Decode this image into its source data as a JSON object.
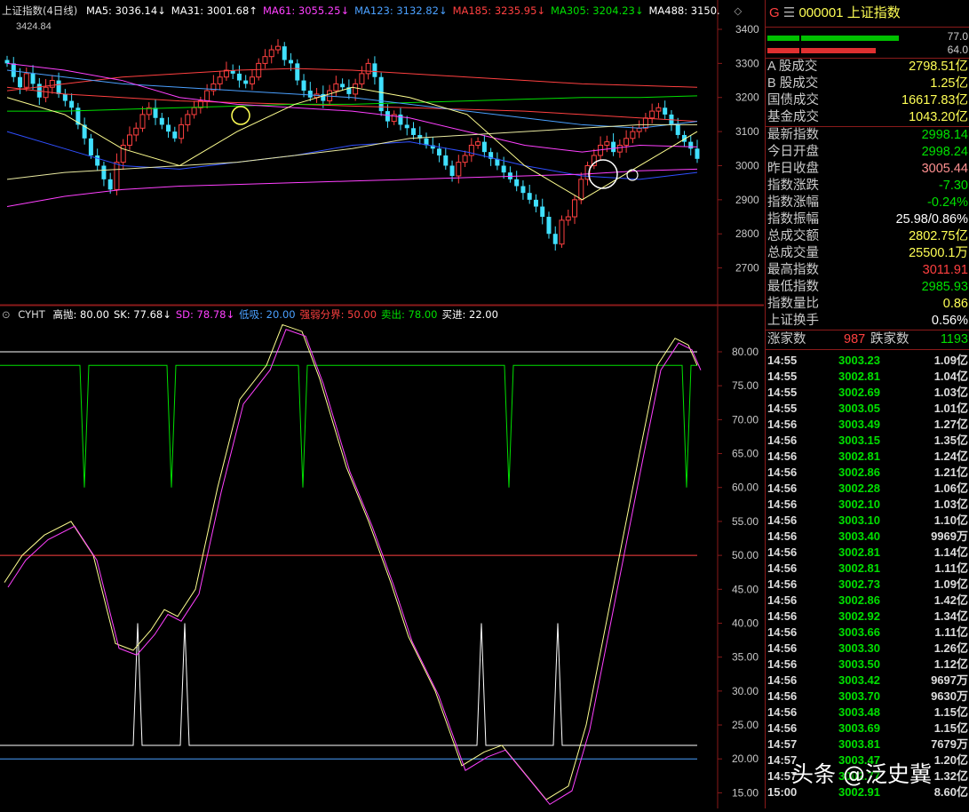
{
  "colors": {
    "red": "#ff4040",
    "green": "#00e000",
    "yellow": "#ffff55",
    "white": "#ffffff",
    "magenta": "#ff40ff",
    "blue": "#4aa0ff",
    "grid": "#8a1a1a",
    "axis": "#c8c8c8"
  },
  "main": {
    "title": "上证指数(4日线)",
    "ma": [
      {
        "label": "MA5: 3036.14",
        "arrow": "↓",
        "color": "#ffffff"
      },
      {
        "label": "MA31: 3001.68",
        "arrow": "↑",
        "color": "#ffffff"
      },
      {
        "label": "MA61: 3055.25",
        "arrow": "↓",
        "color": "#ff40ff"
      },
      {
        "label": "MA123: 3132.82",
        "arrow": "↓",
        "color": "#4aa0ff"
      },
      {
        "label": "MA185: 3235.95",
        "arrow": "↓",
        "color": "#ff4040"
      },
      {
        "label": "MA305: 3204.23",
        "arrow": "↓",
        "color": "#00e000"
      },
      {
        "label": "MA488: 3150.",
        "arrow": "",
        "color": "#ffffff"
      }
    ],
    "hi_label": "3424.84",
    "yticks": [
      "3400",
      "3300",
      "3200",
      "3100",
      "3000",
      "2900",
      "2800",
      "2700"
    ]
  },
  "indicator": {
    "name": "CYHT",
    "items": [
      {
        "label": "高抛: 80.00",
        "color": "#ffffff"
      },
      {
        "label": "SK: 77.68",
        "arrow": "↓",
        "color": "#ffffff"
      },
      {
        "label": "SD: 78.78",
        "arrow": "↓",
        "color": "#ff40ff"
      },
      {
        "label": "低吸: 20.00",
        "color": "#4aa0ff"
      },
      {
        "label": "强弱分界: 50.00",
        "color": "#ff4040"
      },
      {
        "label": "卖出: 78.00",
        "color": "#00e000"
      },
      {
        "label": "买进: 22.00",
        "color": "#ffffff"
      }
    ],
    "yticks": [
      "80.00",
      "75.00",
      "70.00",
      "65.00",
      "60.00",
      "55.00",
      "50.00",
      "45.00",
      "40.00",
      "35.00",
      "30.00",
      "25.00",
      "20.00",
      "15.00"
    ]
  },
  "panel": {
    "g": "G",
    "menu": "☰",
    "code": "000001",
    "name": "上证指数",
    "bar1": "77.0",
    "bar2": "64.0",
    "rows1": [
      {
        "l": "A 股成交",
        "v": "2798.51亿",
        "c": "#ffff55"
      },
      {
        "l": "B 股成交",
        "v": "1.25亿",
        "c": "#ffff55"
      },
      {
        "l": "国债成交",
        "v": "16617.83亿",
        "c": "#ffff55"
      },
      {
        "l": "基金成交",
        "v": "1043.20亿",
        "c": "#ffff55"
      }
    ],
    "rows2": [
      {
        "l": "最新指数",
        "v": "2998.14",
        "c": "#00e000"
      },
      {
        "l": "今日开盘",
        "v": "2998.24",
        "c": "#00e000"
      },
      {
        "l": "昨日收盘",
        "v": "3005.44",
        "c": "#ff9090"
      },
      {
        "l": "指数涨跌",
        "v": "-7.30",
        "c": "#00e000"
      },
      {
        "l": "指数涨幅",
        "v": "-0.24%",
        "c": "#00e000"
      },
      {
        "l": "指数振幅",
        "v": "25.98/0.86%",
        "c": "#ffffff"
      },
      {
        "l": "总成交额",
        "v": "2802.75亿",
        "c": "#ffff55"
      },
      {
        "l": "总成交量",
        "v": "25500.1万",
        "c": "#ffff55"
      },
      {
        "l": "最高指数",
        "v": "3011.91",
        "c": "#ff4040"
      },
      {
        "l": "最低指数",
        "v": "2985.93",
        "c": "#00e000"
      },
      {
        "l": "指数量比",
        "v": "0.86",
        "c": "#ffff55"
      },
      {
        "l": "上证换手",
        "v": "0.56%",
        "c": "#ffffff"
      }
    ],
    "up_label": "涨家数",
    "up": "987",
    "down_label": "跌家数",
    "down": "1193",
    "ticks": [
      {
        "t": "14:55",
        "p": "3003.23",
        "a": "1.09亿"
      },
      {
        "t": "14:55",
        "p": "3002.81",
        "a": "1.04亿"
      },
      {
        "t": "14:55",
        "p": "3002.69",
        "a": "1.03亿"
      },
      {
        "t": "14:55",
        "p": "3003.05",
        "a": "1.01亿"
      },
      {
        "t": "14:56",
        "p": "3003.49",
        "a": "1.27亿"
      },
      {
        "t": "14:56",
        "p": "3003.15",
        "a": "1.35亿"
      },
      {
        "t": "14:56",
        "p": "3002.81",
        "a": "1.24亿"
      },
      {
        "t": "14:56",
        "p": "3002.86",
        "a": "1.21亿"
      },
      {
        "t": "14:56",
        "p": "3002.28",
        "a": "1.06亿"
      },
      {
        "t": "14:56",
        "p": "3002.10",
        "a": "1.03亿"
      },
      {
        "t": "14:56",
        "p": "3003.10",
        "a": "1.10亿"
      },
      {
        "t": "14:56",
        "p": "3003.40",
        "a": "9969万"
      },
      {
        "t": "14:56",
        "p": "3002.81",
        "a": "1.14亿"
      },
      {
        "t": "14:56",
        "p": "3002.81",
        "a": "1.11亿"
      },
      {
        "t": "14:56",
        "p": "3002.73",
        "a": "1.09亿"
      },
      {
        "t": "14:56",
        "p": "3002.86",
        "a": "1.42亿"
      },
      {
        "t": "14:56",
        "p": "3002.92",
        "a": "1.34亿"
      },
      {
        "t": "14:56",
        "p": "3003.66",
        "a": "1.11亿"
      },
      {
        "t": "14:56",
        "p": "3003.30",
        "a": "1.26亿"
      },
      {
        "t": "14:56",
        "p": "3003.50",
        "a": "1.12亿"
      },
      {
        "t": "14:56",
        "p": "3003.42",
        "a": "9697万"
      },
      {
        "t": "14:56",
        "p": "3003.70",
        "a": "9630万"
      },
      {
        "t": "14:56",
        "p": "3003.48",
        "a": "1.15亿"
      },
      {
        "t": "14:56",
        "p": "3003.69",
        "a": "1.15亿"
      },
      {
        "t": "14:57",
        "p": "3003.81",
        "a": "7679万"
      },
      {
        "t": "14:57",
        "p": "3003.47",
        "a": "1.20亿"
      },
      {
        "t": "14:57",
        "p": "3002.77",
        "a": "1.32亿"
      },
      {
        "t": "15:00",
        "p": "3002.91",
        "a": "8.60亿"
      }
    ]
  },
  "watermark": "头条 @泛史冀"
}
